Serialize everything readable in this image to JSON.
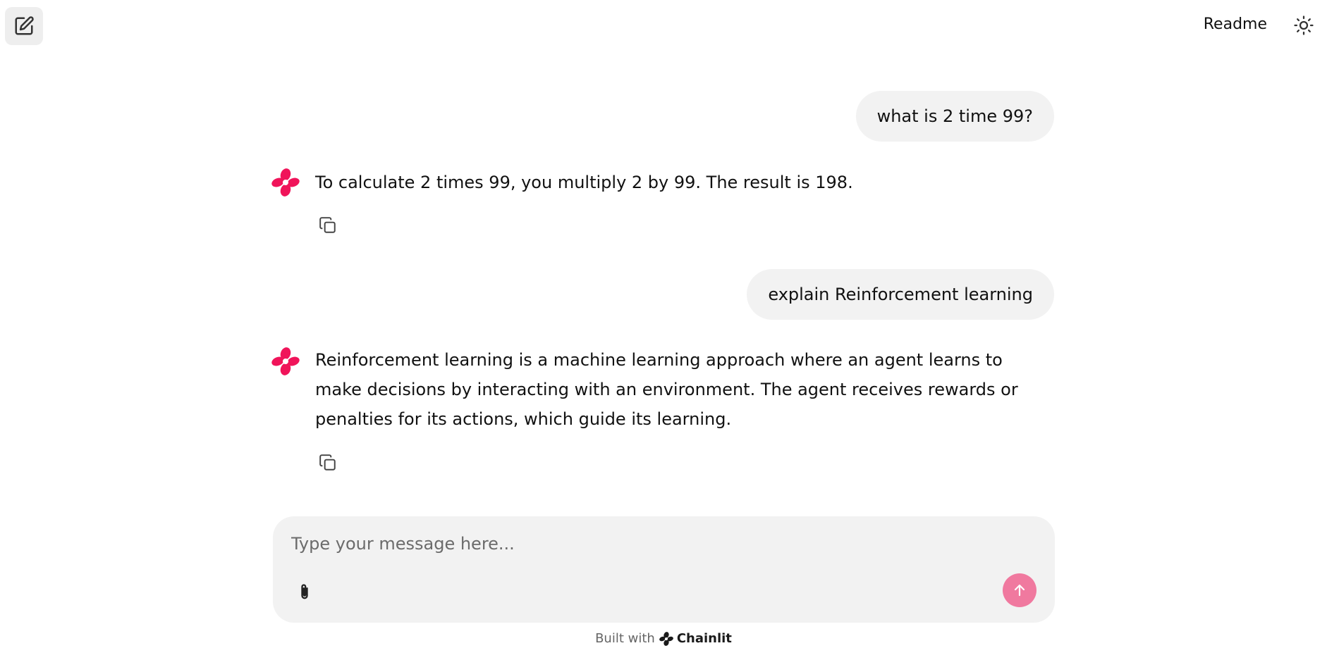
{
  "header": {
    "new_chat_icon": "edit-square-icon",
    "readme_label": "Readme",
    "theme_icon": "sun-icon"
  },
  "messages": [
    {
      "role": "user",
      "text": "what is 2 time 99?"
    },
    {
      "role": "assistant",
      "text": "To calculate 2 times 99, you multiply 2 by 99. The result is 198.",
      "action_icon": "copy-icon"
    },
    {
      "role": "user",
      "text": "explain Reinforcement learning"
    },
    {
      "role": "assistant",
      "text": "Reinforcement learning is a machine learning approach where an agent learns to make decisions by interacting with an environment. The agent receives rewards or penalties for its actions, which guide its learning.",
      "action_icon": "copy-icon"
    }
  ],
  "composer": {
    "placeholder": "Type your message here...",
    "value": "",
    "attach_icon": "paperclip-icon",
    "send_icon": "arrow-up-icon"
  },
  "footer": {
    "prefix": "Built with",
    "brand": "Chainlit"
  },
  "colors": {
    "accent": "#f0799f",
    "avatar": "#f0145a",
    "bubble": "#f2f2f2"
  }
}
